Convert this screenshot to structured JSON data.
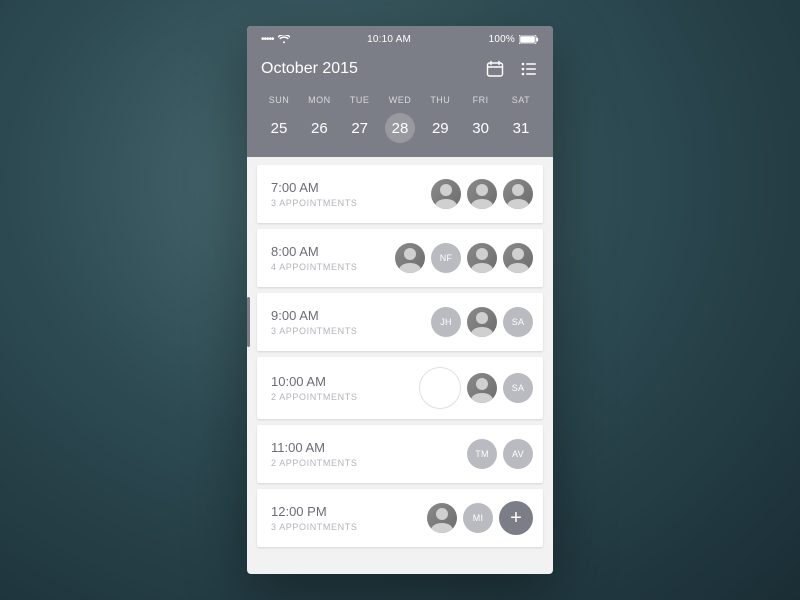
{
  "status": {
    "signal": "•••••",
    "wifi": "wifi",
    "time": "10:10 AM",
    "battery_pct": "100%"
  },
  "header": {
    "title": "October 2015",
    "icons": {
      "calendar": "calendar-icon",
      "list": "list-icon"
    }
  },
  "week": {
    "days": [
      {
        "label": "SUN",
        "num": "25",
        "selected": false
      },
      {
        "label": "MON",
        "num": "26",
        "selected": false
      },
      {
        "label": "TUE",
        "num": "27",
        "selected": false
      },
      {
        "label": "WED",
        "num": "28",
        "selected": true
      },
      {
        "label": "THU",
        "num": "29",
        "selected": false
      },
      {
        "label": "FRI",
        "num": "30",
        "selected": false
      },
      {
        "label": "SAT",
        "num": "31",
        "selected": false
      }
    ]
  },
  "slots": [
    {
      "time": "7:00 AM",
      "count_label": "3 APPOINTMENTS",
      "avatars": [
        {
          "type": "person"
        },
        {
          "type": "person"
        },
        {
          "type": "person"
        }
      ],
      "active": false
    },
    {
      "time": "8:00 AM",
      "count_label": "4 APPOINTMENTS",
      "avatars": [
        {
          "type": "person"
        },
        {
          "type": "initials",
          "text": "NF"
        },
        {
          "type": "person"
        },
        {
          "type": "person"
        }
      ],
      "active": false
    },
    {
      "time": "9:00 AM",
      "count_label": "3 APPOINTMENTS",
      "avatars": [
        {
          "type": "initials",
          "text": "JH"
        },
        {
          "type": "person"
        },
        {
          "type": "initials",
          "text": "SA"
        }
      ],
      "active": true
    },
    {
      "time": "10:00 AM",
      "count_label": "2 APPOINTMENTS",
      "avatars": [
        {
          "type": "ring"
        },
        {
          "type": "person"
        },
        {
          "type": "initials",
          "text": "SA"
        }
      ],
      "active": false
    },
    {
      "time": "11:00 AM",
      "count_label": "2 APPOINTMENTS",
      "avatars": [
        {
          "type": "initials",
          "text": "TM"
        },
        {
          "type": "initials",
          "text": "AV"
        }
      ],
      "active": false
    },
    {
      "time": "12:00 PM",
      "count_label": "3 APPOINTMENTS",
      "avatars": [
        {
          "type": "person"
        },
        {
          "type": "initials",
          "text": "MI"
        },
        {
          "type": "fab",
          "text": "+"
        }
      ],
      "active": false
    }
  ]
}
